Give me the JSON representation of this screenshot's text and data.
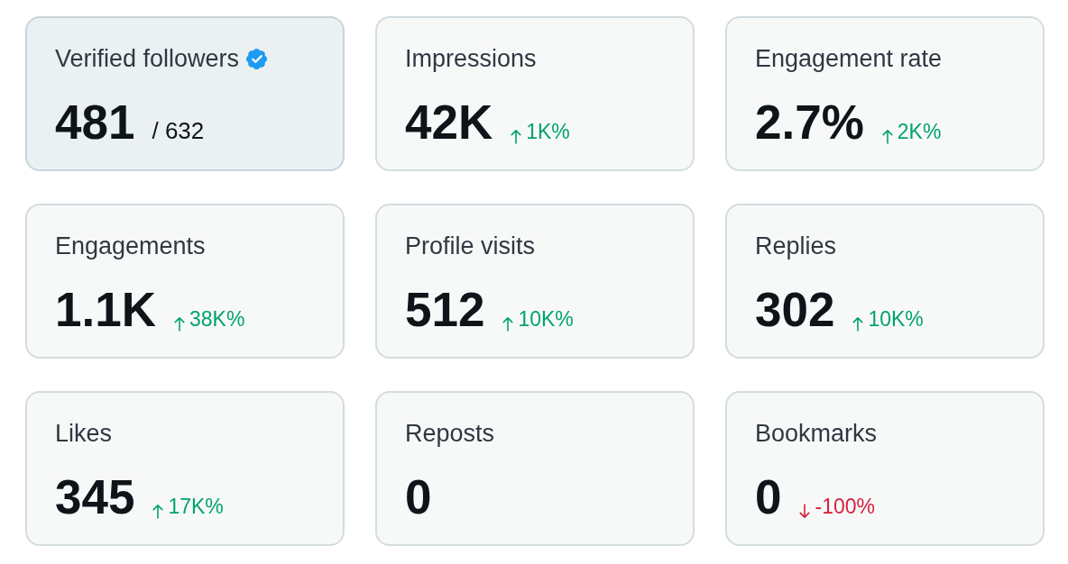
{
  "cards": [
    {
      "title": "Verified followers",
      "verified": true,
      "selected": true,
      "value": "481",
      "total": "/ 632"
    },
    {
      "title": "Impressions",
      "verified": false,
      "selected": false,
      "value": "42K",
      "change": {
        "kind": "up",
        "text": "1K%"
      }
    },
    {
      "title": "Engagement rate",
      "verified": false,
      "selected": false,
      "value": "2.7%",
      "change": {
        "kind": "up",
        "text": "2K%"
      }
    },
    {
      "title": "Engagements",
      "verified": false,
      "selected": false,
      "value": "1.1K",
      "change": {
        "kind": "up",
        "text": "38K%"
      }
    },
    {
      "title": "Profile visits",
      "verified": false,
      "selected": false,
      "value": "512",
      "change": {
        "kind": "up",
        "text": "10K%"
      }
    },
    {
      "title": "Replies",
      "verified": false,
      "selected": false,
      "value": "302",
      "change": {
        "kind": "up",
        "text": "10K%"
      }
    },
    {
      "title": "Likes",
      "verified": false,
      "selected": false,
      "value": "345",
      "change": {
        "kind": "up",
        "text": "17K%"
      }
    },
    {
      "title": "Reposts",
      "verified": false,
      "selected": false,
      "value": "0"
    },
    {
      "title": "Bookmarks",
      "verified": false,
      "selected": false,
      "value": "0",
      "change": {
        "kind": "down",
        "text": "-100%"
      }
    }
  ]
}
